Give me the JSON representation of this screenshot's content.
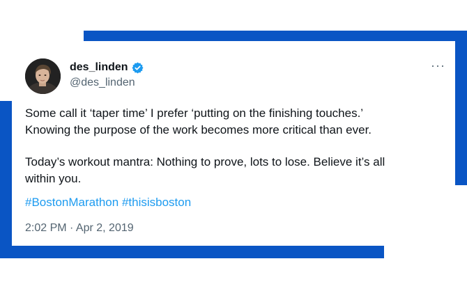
{
  "tweet": {
    "display_name": "des_linden",
    "handle": "@des_linden",
    "more_label": "···",
    "text_line1": "Some call it ‘taper time’ I prefer ‘putting on the finishing touches.’",
    "text_line2": "Knowing the purpose of the work becomes more critical than ever.",
    "text_line3": "Today’s workout mantra: Nothing to prove, lots to lose. Believe it’s all",
    "text_line4": "within you.",
    "hashtags": [
      "#BostonMarathon",
      "#thisisboston"
    ],
    "timestamp": "2:02 PM · Apr 2, 2019"
  },
  "colors": {
    "frame_blue": "#0a55c4",
    "text": "#0f1419",
    "muted": "#536471",
    "link": "#1d9bf0",
    "verified_badge": "#1d9bf0"
  },
  "icons": {
    "verified": "verified-badge-icon",
    "more": "more-options-icon",
    "avatar": "profile-photo"
  }
}
